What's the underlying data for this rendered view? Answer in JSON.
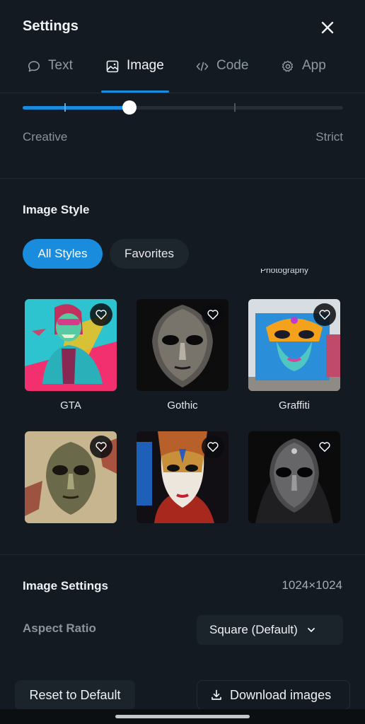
{
  "header": {
    "title": "Settings",
    "close_icon": "close-icon"
  },
  "tabs": [
    {
      "label": "Text",
      "icon": "chat-bubble-icon",
      "active": false
    },
    {
      "label": "Image",
      "icon": "image-icon",
      "active": true
    },
    {
      "label": "Code",
      "icon": "code-icon",
      "active": false
    },
    {
      "label": "App",
      "icon": "gear-icon",
      "active": false
    }
  ],
  "slider": {
    "value_fraction": 0.333,
    "tick_fractions": [
      0.13,
      0.66
    ],
    "min_label": "Creative",
    "max_label": "Strict"
  },
  "image_style": {
    "title": "Image Style",
    "filters": [
      {
        "label": "All Styles",
        "active": true
      },
      {
        "label": "Favorites",
        "active": false
      }
    ],
    "clipped_label": "Photography",
    "styles": [
      {
        "name": "GTA",
        "favorite": false
      },
      {
        "name": "Gothic",
        "favorite": false
      },
      {
        "name": "Graffiti",
        "favorite": false
      },
      {
        "name": "",
        "favorite": false
      },
      {
        "name": "",
        "favorite": false
      },
      {
        "name": "",
        "favorite": false
      }
    ]
  },
  "image_settings": {
    "title": "Image Settings",
    "resolution": "1024×1024",
    "aspect_ratio_label": "Aspect Ratio",
    "aspect_ratio_value": "Square (Default)"
  },
  "footer": {
    "reset_label": "Reset to Default",
    "download_label": "Download images"
  },
  "colors": {
    "accent": "#1a8cde",
    "background": "#141a21",
    "surface": "#1b232b"
  }
}
